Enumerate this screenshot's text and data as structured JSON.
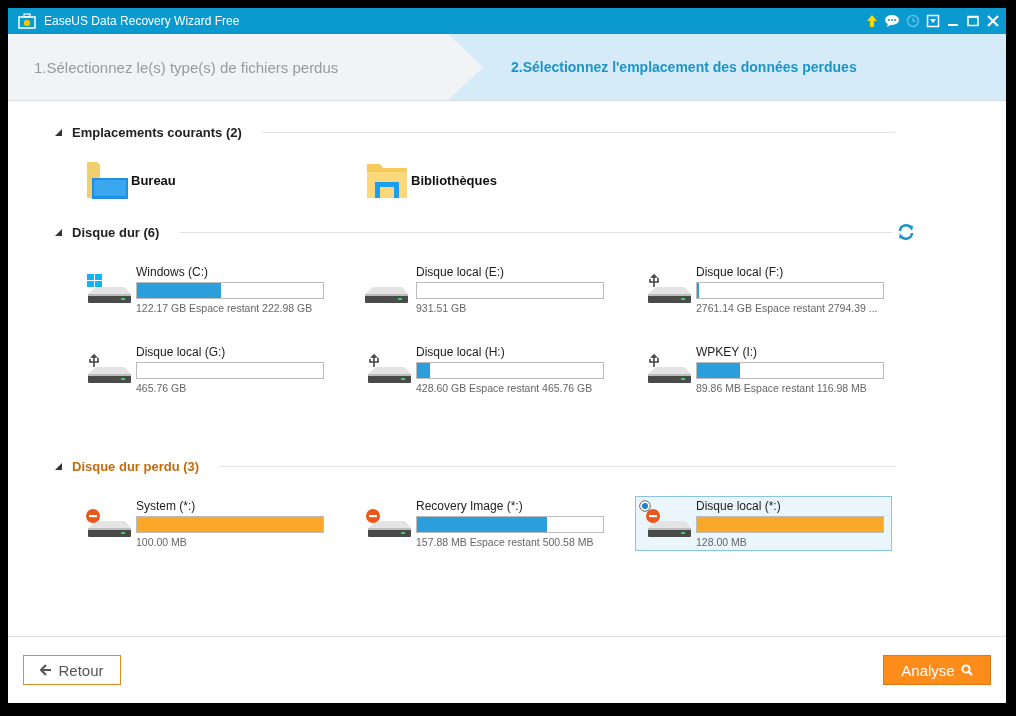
{
  "window": {
    "title": "EaseUS Data Recovery Wizard Free"
  },
  "steps": [
    {
      "label": "1.Sélectionnez le(s) type(s) de fichiers perdus",
      "selected": false
    },
    {
      "label": "2.Sélectionnez l'emplacement des données perdues",
      "selected": true
    }
  ],
  "sections": [
    {
      "kind": "locations",
      "title": "Emplacements courants (2)",
      "expanded": true,
      "refresh": false,
      "items": [
        {
          "kind": "desktop",
          "name": "Bureau"
        },
        {
          "kind": "libraries",
          "name": "Bibliothèques"
        }
      ]
    },
    {
      "kind": "drives",
      "title": "Disque dur (6)",
      "expanded": true,
      "refresh": true,
      "items": [
        {
          "kind": "windows",
          "name": "Windows (C:)",
          "level": 0.45,
          "color": "#2a9fdc",
          "info": "122.17 GB Espace restant 222.98 GB",
          "selected": false
        },
        {
          "kind": "plain",
          "name": "Disque local (E:)",
          "level": 0,
          "info": "931.51 GB",
          "selected": false
        },
        {
          "kind": "usb",
          "name": "Disque local (F:)",
          "level": 0.01,
          "info": "2761.14 GB Espace restant 2794.39 ...",
          "selected": false
        },
        {
          "kind": "usb",
          "name": "Disque local (G:)",
          "level": 0,
          "info": "465.76 GB",
          "selected": false
        },
        {
          "kind": "usb",
          "name": "Disque local (H:)",
          "level": 0.07,
          "color": "#2a9fdc",
          "info": "428.60 GB Espace restant 465.76 GB",
          "selected": false
        },
        {
          "kind": "usb",
          "name": "WPKEY (I:)",
          "level": 0.23,
          "color": "#2a9fdc",
          "info": "89.86 MB Espace restant 116.98 MB",
          "selected": false
        }
      ]
    },
    {
      "kind": "lost_drives",
      "title": "Disque dur perdu (3)",
      "expanded": true,
      "refresh": false,
      "items": [
        {
          "kind": "lost",
          "name": "System (*:)",
          "level": 1,
          "color": "#fba828",
          "info": "100.00 MB",
          "selected": false
        },
        {
          "kind": "lost",
          "name": "Recovery Image (*:)",
          "level": 0.7,
          "color": "#2a9fdc",
          "info": "157.88 MB Espace restant 500.58 MB",
          "selected": false
        },
        {
          "kind": "lost",
          "name": "Disque local (*:)",
          "level": 1,
          "color": "#fba828",
          "info": "128.00 MB",
          "selected": true
        }
      ]
    }
  ],
  "buttons": {
    "back": "Retour",
    "next": "Analyse"
  }
}
